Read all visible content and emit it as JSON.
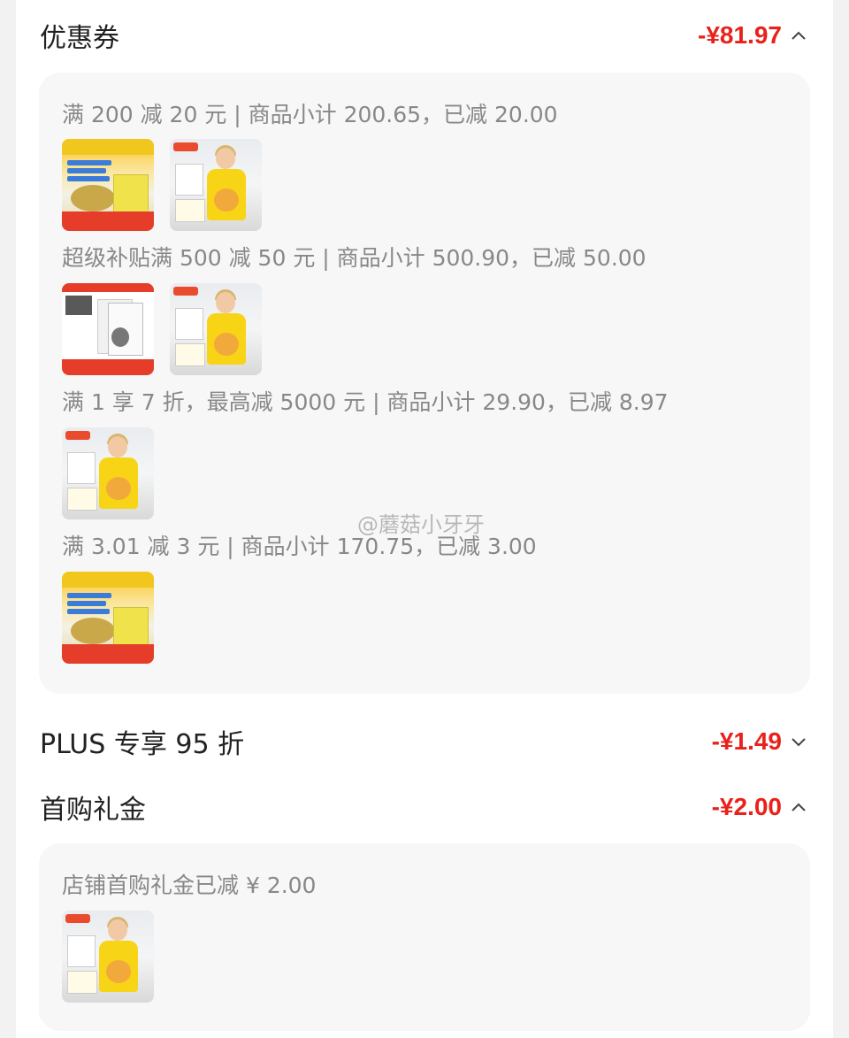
{
  "sections": {
    "coupon": {
      "title": "优惠券",
      "amount": "-¥81.97",
      "expanded": true
    },
    "plus": {
      "title": "PLUS 专享 95 折",
      "amount": "-¥1.49",
      "expanded": false
    },
    "first_buy": {
      "title": "首购礼金",
      "amount": "-¥2.00",
      "expanded": true
    }
  },
  "coupon_groups": [
    {
      "text": "满 200 减 20 元 | 商品小计 200.65，已减 20.00",
      "items": [
        "food-product",
        "kid-apron-product"
      ]
    },
    {
      "text": "超级补贴满 500 减 50 元 | 商品小计 500.90，已减 50.00",
      "items": [
        "cat-food-product",
        "kid-apron-product"
      ]
    },
    {
      "text": "满 1 享 7 折，最高减 5000 元 | 商品小计 29.90，已减 8.97",
      "items": [
        "kid-apron-product"
      ]
    },
    {
      "text": "满 3.01 减 3 元 | 商品小计 170.75，已减 3.00",
      "items": [
        "food-product"
      ]
    }
  ],
  "first_buy_group": {
    "text": "店铺首购礼金已减 ¥ 2.00",
    "items": [
      "kid-apron-product"
    ]
  },
  "watermark": "@蘑菇小牙牙",
  "colors": {
    "accent": "#e8221b",
    "panel": "#f7f7f7",
    "muted_text": "#888888"
  },
  "icons": {
    "expanded": "chevron-up-icon",
    "collapsed": "chevron-down-icon"
  }
}
